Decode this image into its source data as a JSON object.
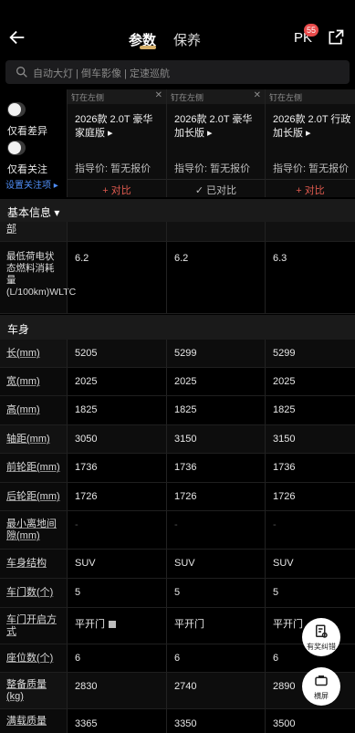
{
  "header": {
    "tabs": [
      {
        "label": "参数"
      },
      {
        "label": "保养"
      }
    ],
    "pk_label": "PK",
    "pk_badge": "55"
  },
  "search": {
    "text": "自动大灯 | 倒车影像 | 定速巡航"
  },
  "filters": {
    "diff_label": "仅看差异",
    "focus_label": "仅看关注",
    "setting_link": "设置关注项 ▸"
  },
  "cars": [
    {
      "pin": "钉在左侧",
      "name": "2026款 2.0T 豪华家庭版 ▸",
      "price": "指导价:  暂无报价",
      "action": "+ 对比"
    },
    {
      "pin": "钉在左侧",
      "name": "2026款 2.0T 豪华加长版 ▸",
      "price": "指导价:  暂无报价",
      "action": "✓ 已对比"
    },
    {
      "pin": "钉在左侧",
      "name": "2026款 2.0T 行政加长版 ▸",
      "price": "指导价:  暂无报价",
      "action": "+ 对比"
    }
  ],
  "sections": {
    "basic": "基本信息 ▾",
    "body": "车身"
  },
  "rows": [
    {
      "label": "部",
      "values": [
        "",
        "",
        ""
      ]
    },
    {
      "label": "最低荷电状态燃料消耗量(L/100km)WLTC",
      "values": [
        "6.2",
        "6.2",
        "6.3"
      ]
    },
    {
      "label": "长(mm)",
      "values": [
        "5205",
        "5299",
        "5299"
      ]
    },
    {
      "label": "宽(mm)",
      "values": [
        "2025",
        "2025",
        "2025"
      ]
    },
    {
      "label": "高(mm)",
      "values": [
        "1825",
        "1825",
        "1825"
      ]
    },
    {
      "label": "轴距(mm)",
      "values": [
        "3050",
        "3150",
        "3150"
      ]
    },
    {
      "label": "前轮距(mm)",
      "values": [
        "1736",
        "1736",
        "1736"
      ]
    },
    {
      "label": "后轮距(mm)",
      "values": [
        "1726",
        "1726",
        "1726"
      ]
    },
    {
      "label": "最小离地间隙(mm)",
      "values": [
        "-",
        "-",
        "-"
      ]
    },
    {
      "label": "车身结构",
      "values": [
        "SUV",
        "SUV",
        "SUV"
      ]
    },
    {
      "label": "车门数(个)",
      "values": [
        "5",
        "5",
        "5"
      ]
    },
    {
      "label": "车门开启方式",
      "values": [
        "平开门",
        "平开门",
        "平开门"
      ]
    },
    {
      "label": "座位数(个)",
      "values": [
        "6",
        "6",
        "6"
      ]
    },
    {
      "label": "整备质量(kg)",
      "values": [
        "2830",
        "2740",
        "2890"
      ]
    },
    {
      "label": "满载质量",
      "values": [
        "3365",
        "3350",
        "3500"
      ]
    }
  ],
  "fabs": {
    "feedback": "有奖纠错",
    "landscape": "横屏"
  }
}
